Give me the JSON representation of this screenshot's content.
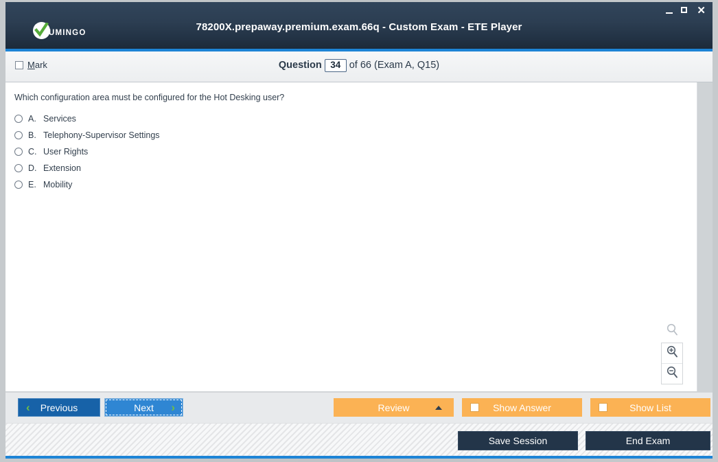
{
  "window": {
    "title": "78200X.prepaway.premium.exam.66q - Custom Exam - ETE Player",
    "logo_text": "UMINGO",
    "controls": {
      "minimize": "minimize-icon",
      "maximize": "maximize-icon",
      "close": "✕"
    },
    "colors": {
      "titlebar_top": "#31455b",
      "titlebar_bottom": "#1b2836",
      "accent_blue": "#1d84d6",
      "primary_button": "#1762a8",
      "focused_button": "#2f86d3",
      "orange_button": "#fbb254",
      "dark_button": "#233549",
      "chevron_green": "#6fbe44"
    }
  },
  "header": {
    "mark_label_prefix": "M",
    "mark_label_rest": "ark",
    "mark_checked": false,
    "question_label": "Question",
    "question_number": "34",
    "question_rest": "of 66 (Exam A, Q15)"
  },
  "question": {
    "text": "Which configuration area must be configured for the Hot Desking user?",
    "options": [
      {
        "letter": "A.",
        "text": "Services",
        "selected": false
      },
      {
        "letter": "B.",
        "text": "Telephony-Supervisor Settings",
        "selected": false
      },
      {
        "letter": "C.",
        "text": "User Rights",
        "selected": false
      },
      {
        "letter": "D.",
        "text": "Extension",
        "selected": false
      },
      {
        "letter": "E.",
        "text": "Mobility",
        "selected": false
      }
    ]
  },
  "zoom_controls": {
    "reset": "magnifier-icon",
    "zoom_in": "zoom-in-icon",
    "zoom_out": "zoom-out-icon"
  },
  "toolbar": {
    "previous": "Previous",
    "next": "Next",
    "review": "Review",
    "show_answer": "Show Answer",
    "show_list": "Show List",
    "show_answer_checked": false,
    "show_list_checked": false
  },
  "statusbar": {
    "save_session": "Save Session",
    "end_exam": "End Exam"
  }
}
